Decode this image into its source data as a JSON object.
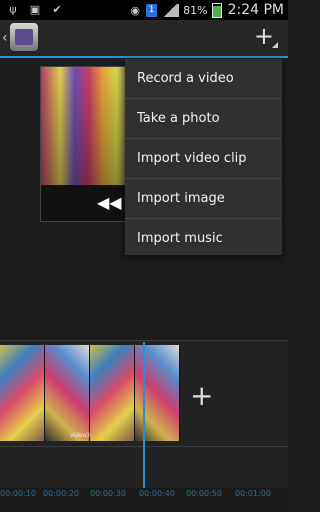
{
  "status_bar": {
    "icons": [
      "usb-icon",
      "image-icon",
      "check-icon",
      "eye-icon"
    ],
    "sim_label": "1",
    "battery_percent": "81%",
    "time": "2:24 PM"
  },
  "action_bar": {
    "back_glyph": "‹",
    "add_glyph": "+"
  },
  "menu": {
    "items": [
      "Record a video",
      "Take a photo",
      "Import video clip",
      "Import image",
      "Import music"
    ]
  },
  "preview": {
    "rewind_glyph": "◀◀"
  },
  "timeline": {
    "clip_label": "video3",
    "add_glyph": "+",
    "ruler_ticks": [
      "00:00:10",
      "00:00:20",
      "00:00:30",
      "00:00:40",
      "00:00:50",
      "00:01:00"
    ]
  },
  "colors": {
    "accent": "#2b8fd0",
    "background": "#1c1c1c",
    "menu_bg": "#303030"
  }
}
